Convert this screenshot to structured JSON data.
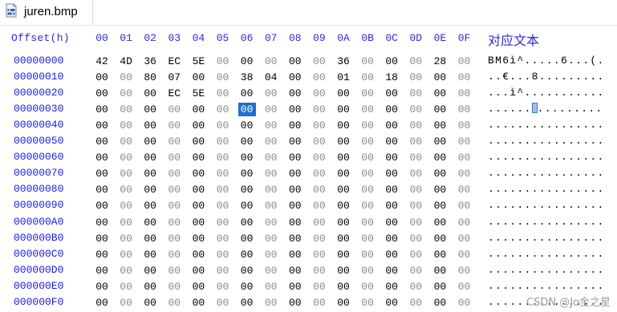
{
  "tab": {
    "filename": "juren.bmp",
    "icon": "bmp-file-icon"
  },
  "header": {
    "offset_label": "Offset(h)",
    "columns": [
      "00",
      "01",
      "02",
      "03",
      "04",
      "05",
      "06",
      "07",
      "08",
      "09",
      "0A",
      "0B",
      "0C",
      "0D",
      "0E",
      "0F"
    ],
    "text_label": "对应文本"
  },
  "rows": [
    {
      "offset": "00000000",
      "bytes": [
        "42",
        "4D",
        "36",
        "EC",
        "5E",
        "00",
        "00",
        "00",
        "00",
        "00",
        "36",
        "00",
        "00",
        "00",
        "28",
        "00"
      ],
      "ascii": "BM6ì^.....6...(."
    },
    {
      "offset": "00000010",
      "bytes": [
        "00",
        "00",
        "80",
        "07",
        "00",
        "00",
        "38",
        "04",
        "00",
        "00",
        "01",
        "00",
        "18",
        "00",
        "00",
        "00"
      ],
      "ascii": "..€...8........."
    },
    {
      "offset": "00000020",
      "bytes": [
        "00",
        "00",
        "00",
        "EC",
        "5E",
        "00",
        "00",
        "00",
        "00",
        "00",
        "00",
        "00",
        "00",
        "00",
        "00",
        "00"
      ],
      "ascii": "...ì^..........."
    },
    {
      "offset": "00000030",
      "bytes": [
        "00",
        "00",
        "00",
        "00",
        "00",
        "00",
        "00",
        "00",
        "00",
        "00",
        "00",
        "00",
        "00",
        "00",
        "00",
        "00"
      ],
      "ascii_before": "......",
      "ascii_after": "........."
    },
    {
      "offset": "00000040",
      "bytes": [
        "00",
        "00",
        "00",
        "00",
        "00",
        "00",
        "00",
        "00",
        "00",
        "00",
        "00",
        "00",
        "00",
        "00",
        "00",
        "00"
      ],
      "ascii": "................"
    },
    {
      "offset": "00000050",
      "bytes": [
        "00",
        "00",
        "00",
        "00",
        "00",
        "00",
        "00",
        "00",
        "00",
        "00",
        "00",
        "00",
        "00",
        "00",
        "00",
        "00"
      ],
      "ascii": "................"
    },
    {
      "offset": "00000060",
      "bytes": [
        "00",
        "00",
        "00",
        "00",
        "00",
        "00",
        "00",
        "00",
        "00",
        "00",
        "00",
        "00",
        "00",
        "00",
        "00",
        "00"
      ],
      "ascii": "................"
    },
    {
      "offset": "00000070",
      "bytes": [
        "00",
        "00",
        "00",
        "00",
        "00",
        "00",
        "00",
        "00",
        "00",
        "00",
        "00",
        "00",
        "00",
        "00",
        "00",
        "00"
      ],
      "ascii": "................"
    },
    {
      "offset": "00000080",
      "bytes": [
        "00",
        "00",
        "00",
        "00",
        "00",
        "00",
        "00",
        "00",
        "00",
        "00",
        "00",
        "00",
        "00",
        "00",
        "00",
        "00"
      ],
      "ascii": "................"
    },
    {
      "offset": "00000090",
      "bytes": [
        "00",
        "00",
        "00",
        "00",
        "00",
        "00",
        "00",
        "00",
        "00",
        "00",
        "00",
        "00",
        "00",
        "00",
        "00",
        "00"
      ],
      "ascii": "................"
    },
    {
      "offset": "000000A0",
      "bytes": [
        "00",
        "00",
        "00",
        "00",
        "00",
        "00",
        "00",
        "00",
        "00",
        "00",
        "00",
        "00",
        "00",
        "00",
        "00",
        "00"
      ],
      "ascii": "................"
    },
    {
      "offset": "000000B0",
      "bytes": [
        "00",
        "00",
        "00",
        "00",
        "00",
        "00",
        "00",
        "00",
        "00",
        "00",
        "00",
        "00",
        "00",
        "00",
        "00",
        "00"
      ],
      "ascii": "................"
    },
    {
      "offset": "000000C0",
      "bytes": [
        "00",
        "00",
        "00",
        "00",
        "00",
        "00",
        "00",
        "00",
        "00",
        "00",
        "00",
        "00",
        "00",
        "00",
        "00",
        "00"
      ],
      "ascii": "................"
    },
    {
      "offset": "000000D0",
      "bytes": [
        "00",
        "00",
        "00",
        "00",
        "00",
        "00",
        "00",
        "00",
        "00",
        "00",
        "00",
        "00",
        "00",
        "00",
        "00",
        "00"
      ],
      "ascii": "................"
    },
    {
      "offset": "000000E0",
      "bytes": [
        "00",
        "00",
        "00",
        "00",
        "00",
        "00",
        "00",
        "00",
        "00",
        "00",
        "00",
        "00",
        "00",
        "00",
        "00",
        "00"
      ],
      "ascii": "................"
    },
    {
      "offset": "000000F0",
      "bytes": [
        "00",
        "00",
        "00",
        "00",
        "00",
        "00",
        "00",
        "00",
        "00",
        "00",
        "00",
        "00",
        "00",
        "00",
        "00",
        "00"
      ],
      "ascii": "................"
    }
  ],
  "selection": {
    "row": 3,
    "column": 6
  },
  "colors": {
    "header": "#2a2ad8",
    "offset": "#1a1ae0",
    "selection": "#1f6fd0",
    "zero_byte": "#8a8a8a"
  },
  "watermark": "CSDN @Jo金之星"
}
